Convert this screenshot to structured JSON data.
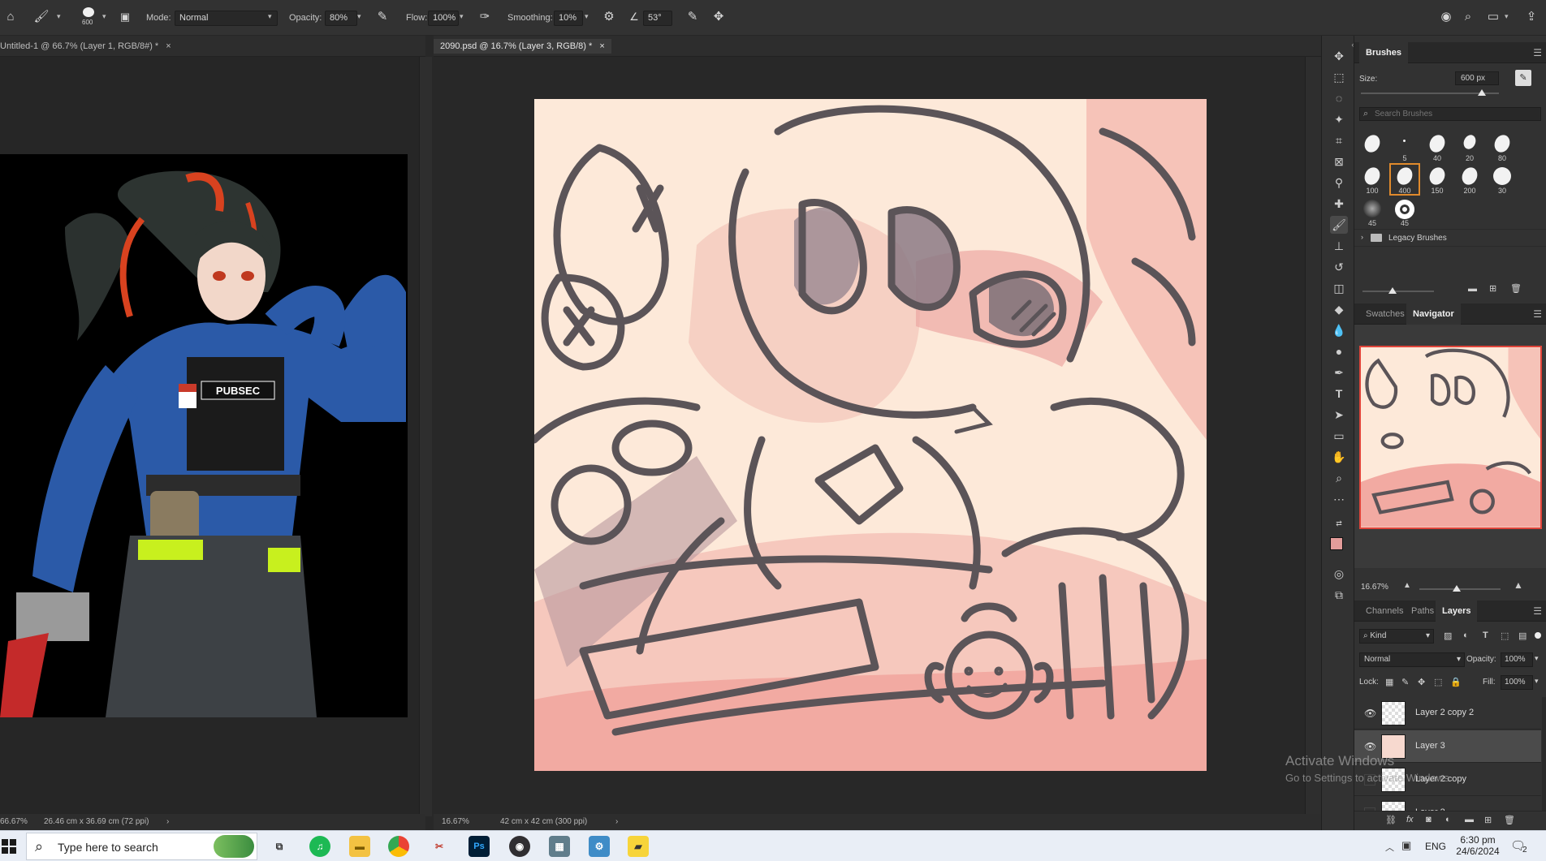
{
  "options_bar": {
    "brush_size_preview": "600",
    "mode_label": "Mode:",
    "mode_value": "Normal",
    "opacity_label": "Opacity:",
    "opacity_value": "80%",
    "flow_label": "Flow:",
    "flow_value": "100%",
    "smoothing_label": "Smoothing:",
    "smoothing_value": "10%",
    "angle_value": "53°"
  },
  "documents": {
    "left_tab": "Untitled-1 @ 66.7% (Layer 1, RGB/8#) *",
    "main_tab": "2090.psd @ 16.7% (Layer 3, RGB/8) *",
    "left_status_zoom": "66.67%",
    "left_status_info": "26.46 cm x 36.69 cm (72 ppi)",
    "main_status_zoom": "16.67%",
    "main_status_info": "42 cm x 42 cm (300 ppi)",
    "left_artwork_badge": "PUBSEC"
  },
  "brushes_panel": {
    "tab": "Brushes",
    "size_label": "Size:",
    "size_value": "600 px",
    "search_placeholder": "Search Brushes",
    "presets": [
      {
        "label": ""
      },
      {
        "label": "5"
      },
      {
        "label": "40"
      },
      {
        "label": "20"
      },
      {
        "label": "80"
      },
      {
        "label": "100"
      },
      {
        "label": "400"
      },
      {
        "label": "150"
      },
      {
        "label": "200"
      },
      {
        "label": "30"
      },
      {
        "label": "45"
      },
      {
        "label": "45"
      }
    ],
    "legacy_group": "Legacy Brushes"
  },
  "navigator_panel": {
    "tabs": [
      "Swatches",
      "Navigator"
    ],
    "active_tab": "Navigator",
    "zoom_value": "16.67%"
  },
  "layers_panel": {
    "tabs": [
      "Channels",
      "Paths",
      "Layers"
    ],
    "active_tab": "Layers",
    "filter_kind": "Kind",
    "blend_mode": "Normal",
    "opacity_label": "Opacity:",
    "opacity_value": "100%",
    "lock_label": "Lock:",
    "fill_label": "Fill:",
    "fill_value": "100%",
    "layers": [
      {
        "name": "Layer 2 copy 2",
        "visible": true,
        "selected": false
      },
      {
        "name": "Layer 3",
        "visible": true,
        "selected": true
      },
      {
        "name": "Layer 2 copy",
        "visible": false,
        "selected": false
      },
      {
        "name": "Layer 2",
        "visible": false,
        "selected": false
      }
    ]
  },
  "watermark": {
    "line1": "Activate Windows",
    "line2": "Go to Settings to activate Windows."
  },
  "taskbar": {
    "search_placeholder": "Type here to search",
    "language": "ENG",
    "time": "6:30 pm",
    "date": "24/6/2024",
    "notification_count": "2",
    "apps": [
      "task-view",
      "spotify",
      "file-explorer",
      "chrome",
      "snipping-tool",
      "photoshop",
      "obs",
      "calculator",
      "control-panel",
      "sticky-notes"
    ]
  },
  "colors": {
    "foreground": "#e39c9a",
    "background": "#ffffff",
    "accent_selected_brush": "#e08a2c"
  }
}
